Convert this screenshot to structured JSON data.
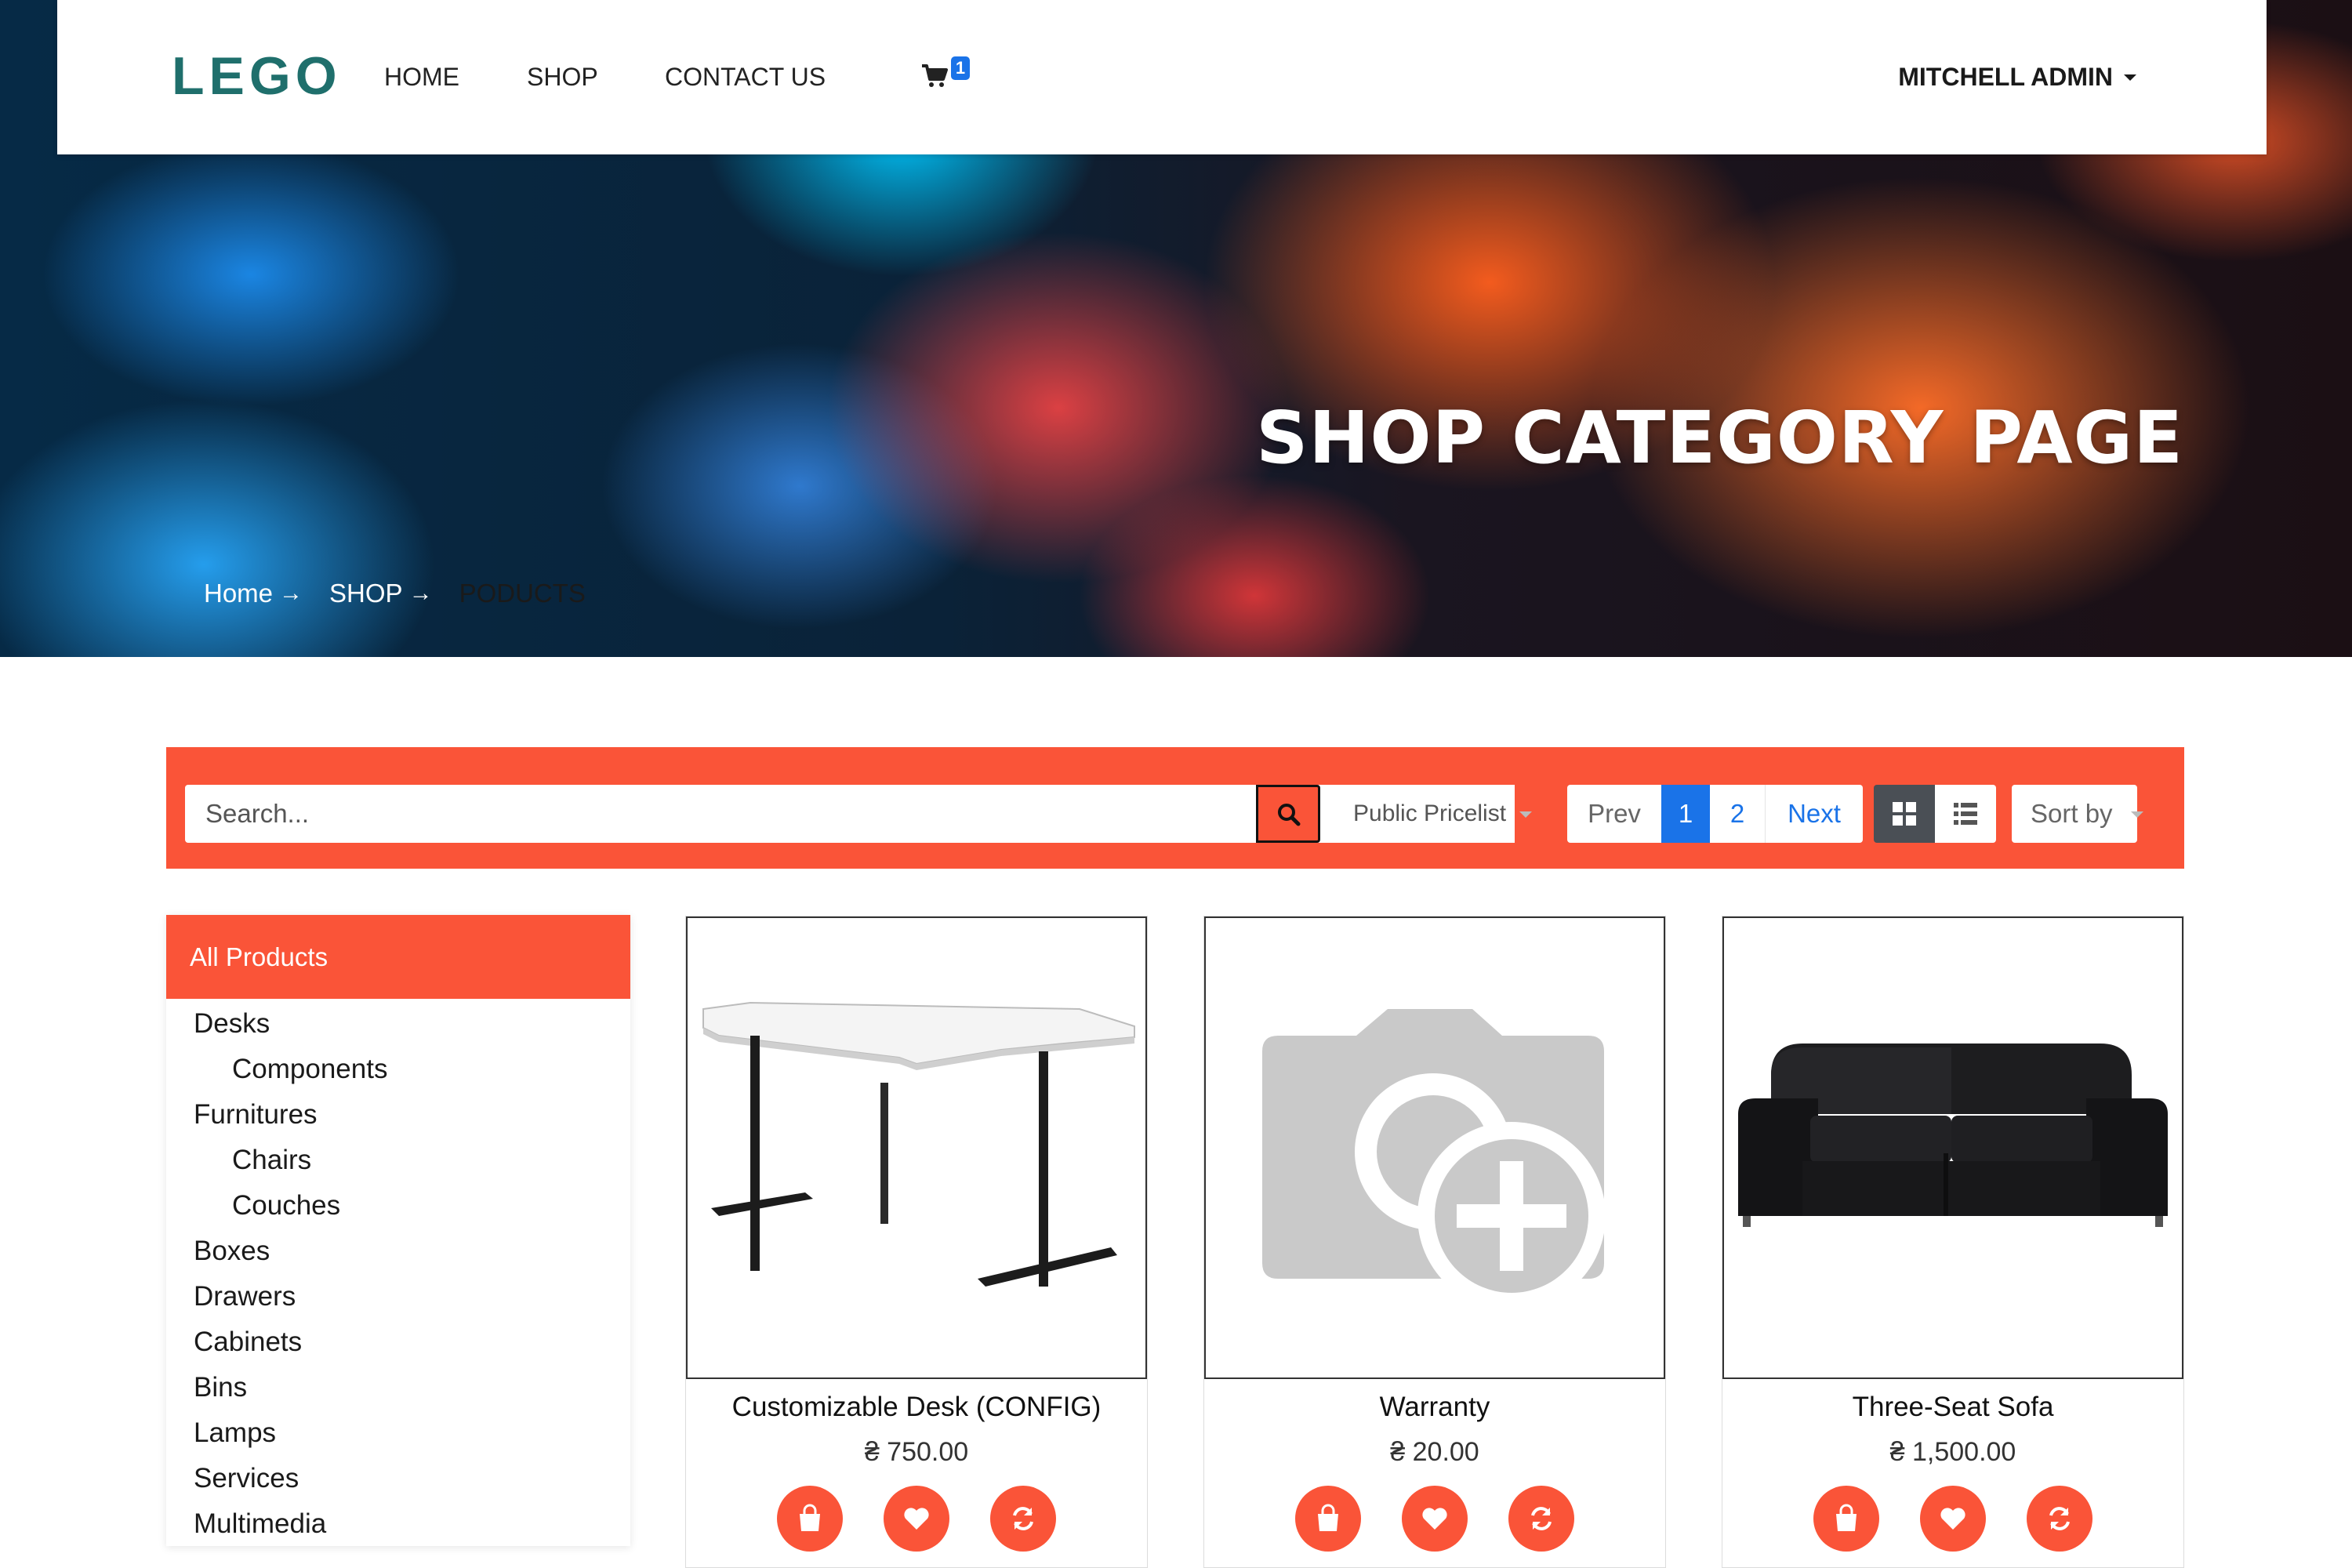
{
  "nav": {
    "logo": "LEGO",
    "links": [
      "HOME",
      "SHOP",
      "CONTACT US"
    ],
    "cart_count": "1",
    "user": "MITCHELL ADMIN"
  },
  "hero": {
    "title": "SHOP CATEGORY PAGE",
    "breadcrumb": [
      "Home",
      "SHOP",
      "PODUCTS"
    ]
  },
  "toolbar": {
    "search_placeholder": "Search...",
    "pricelist": "Public Pricelist",
    "pager": {
      "prev": "Prev",
      "pages": [
        "1",
        "2"
      ],
      "current": "1",
      "next": "Next"
    },
    "sort_label": "Sort by"
  },
  "sidebar": {
    "header": "All Products",
    "categories": [
      {
        "label": "Desks",
        "level": 0
      },
      {
        "label": "Components",
        "level": 1
      },
      {
        "label": "Furnitures",
        "level": 0
      },
      {
        "label": "Chairs",
        "level": 1
      },
      {
        "label": "Couches",
        "level": 1
      },
      {
        "label": "Boxes",
        "level": 0
      },
      {
        "label": "Drawers",
        "level": 0
      },
      {
        "label": "Cabinets",
        "level": 0
      },
      {
        "label": "Bins",
        "level": 0
      },
      {
        "label": "Lamps",
        "level": 0
      },
      {
        "label": "Services",
        "level": 0
      },
      {
        "label": "Multimedia",
        "level": 0
      }
    ]
  },
  "products": [
    {
      "name": "Customizable Desk (CONFIG)",
      "price": "₴ 750.00",
      "image": "desk"
    },
    {
      "name": "Warranty",
      "price": "₴ 20.00",
      "image": "placeholder-camera"
    },
    {
      "name": "Three-Seat Sofa",
      "price": "₴ 1,500.00",
      "image": "sofa"
    }
  ],
  "colors": {
    "accent": "#fa5438",
    "logo": "#1f6f6c",
    "link_blue": "#1a73e8"
  },
  "icons": {
    "product_actions": [
      "shopping-bag-icon",
      "heart-icon",
      "refresh-icon"
    ],
    "view_modes": [
      "grid-view-icon",
      "list-view-icon"
    ]
  }
}
